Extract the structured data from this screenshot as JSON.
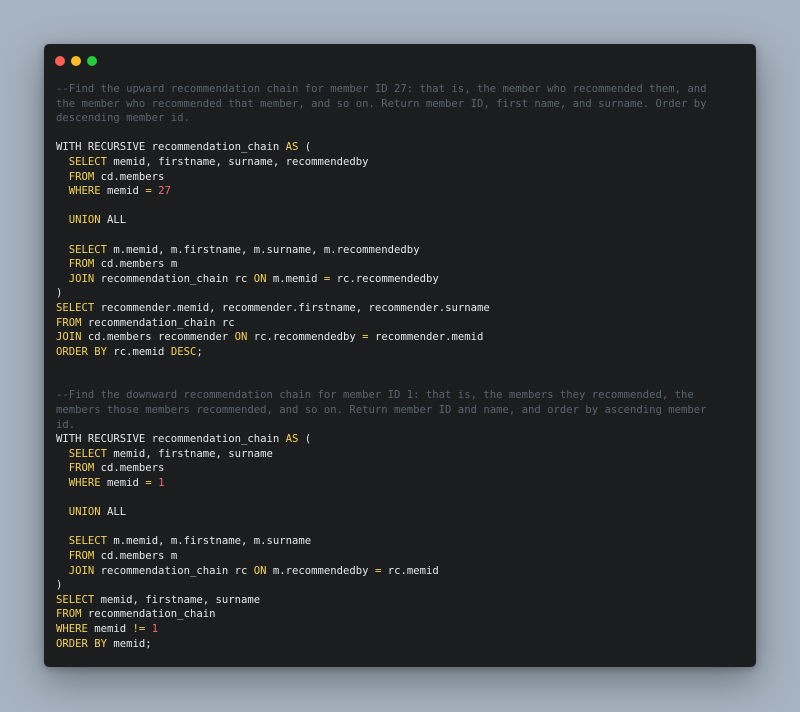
{
  "window": {
    "buttons": [
      {
        "name": "close",
        "color": "#ff5f57"
      },
      {
        "name": "minimize",
        "color": "#febc2e"
      },
      {
        "name": "zoom",
        "color": "#28c840"
      }
    ]
  },
  "colors": {
    "background": "#a6b3c0",
    "window": "#1c1d1f",
    "keyword": "#f4d35e",
    "number": "#ef6b73",
    "comment": "#5b6470",
    "text": "#e6e6e6"
  },
  "code": {
    "lines": [
      [
        [
          "c",
          "--Find the upward recommendation chain for member ID 27: that is, the member who recommended them, and"
        ]
      ],
      [
        [
          "c",
          "the member who recommended that member, and so on. Return member ID, first name, and surname. Order by"
        ]
      ],
      [
        [
          "c",
          "descending member id."
        ]
      ],
      [],
      [
        [
          "t",
          "WITH RECURSIVE recommendation_chain "
        ],
        [
          "k",
          "AS"
        ],
        [
          "t",
          " ("
        ]
      ],
      [
        [
          "t",
          "  "
        ],
        [
          "k",
          "SELECT"
        ],
        [
          "t",
          " memid, firstname, surname, recommendedby"
        ]
      ],
      [
        [
          "t",
          "  "
        ],
        [
          "k",
          "FROM"
        ],
        [
          "t",
          " cd.members"
        ]
      ],
      [
        [
          "t",
          "  "
        ],
        [
          "k",
          "WHERE"
        ],
        [
          "t",
          " memid "
        ],
        [
          "o",
          "="
        ],
        [
          "t",
          " "
        ],
        [
          "n",
          "27"
        ]
      ],
      [],
      [
        [
          "t",
          "  "
        ],
        [
          "k",
          "UNION"
        ],
        [
          "t",
          " ALL"
        ]
      ],
      [],
      [
        [
          "t",
          "  "
        ],
        [
          "k",
          "SELECT"
        ],
        [
          "t",
          " m.memid, m.firstname, m.surname, m.recommendedby"
        ]
      ],
      [
        [
          "t",
          "  "
        ],
        [
          "k",
          "FROM"
        ],
        [
          "t",
          " cd.members m"
        ]
      ],
      [
        [
          "t",
          "  "
        ],
        [
          "k",
          "JOIN"
        ],
        [
          "t",
          " recommendation_chain rc "
        ],
        [
          "k",
          "ON"
        ],
        [
          "t",
          " m.memid "
        ],
        [
          "o",
          "="
        ],
        [
          "t",
          " rc.recommendedby"
        ]
      ],
      [
        [
          "t",
          ")"
        ]
      ],
      [
        [
          "k",
          "SELECT"
        ],
        [
          "t",
          " recommender.memid, recommender.firstname, recommender.surname"
        ]
      ],
      [
        [
          "k",
          "FROM"
        ],
        [
          "t",
          " recommendation_chain rc"
        ]
      ],
      [
        [
          "k",
          "JOIN"
        ],
        [
          "t",
          " cd.members recommender "
        ],
        [
          "k",
          "ON"
        ],
        [
          "t",
          " rc.recommendedby "
        ],
        [
          "o",
          "="
        ],
        [
          "t",
          " recommender.memid"
        ]
      ],
      [
        [
          "k",
          "ORDER BY"
        ],
        [
          "t",
          " rc.memid "
        ],
        [
          "k",
          "DESC"
        ],
        [
          "t",
          ";"
        ]
      ],
      [],
      [],
      [
        [
          "c",
          "--Find the downward recommendation chain for member ID 1: that is, the members they recommended, the"
        ]
      ],
      [
        [
          "c",
          "members those members recommended, and so on. Return member ID and name, and order by ascending member"
        ]
      ],
      [
        [
          "c",
          "id."
        ]
      ],
      [
        [
          "t",
          "WITH RECURSIVE recommendation_chain "
        ],
        [
          "k",
          "AS"
        ],
        [
          "t",
          " ("
        ]
      ],
      [
        [
          "t",
          "  "
        ],
        [
          "k",
          "SELECT"
        ],
        [
          "t",
          " memid, firstname, surname"
        ]
      ],
      [
        [
          "t",
          "  "
        ],
        [
          "k",
          "FROM"
        ],
        [
          "t",
          " cd.members"
        ]
      ],
      [
        [
          "t",
          "  "
        ],
        [
          "k",
          "WHERE"
        ],
        [
          "t",
          " memid "
        ],
        [
          "o",
          "="
        ],
        [
          "t",
          " "
        ],
        [
          "n",
          "1"
        ]
      ],
      [],
      [
        [
          "t",
          "  "
        ],
        [
          "k",
          "UNION"
        ],
        [
          "t",
          " ALL"
        ]
      ],
      [],
      [
        [
          "t",
          "  "
        ],
        [
          "k",
          "SELECT"
        ],
        [
          "t",
          " m.memid, m.firstname, m.surname"
        ]
      ],
      [
        [
          "t",
          "  "
        ],
        [
          "k",
          "FROM"
        ],
        [
          "t",
          " cd.members m"
        ]
      ],
      [
        [
          "t",
          "  "
        ],
        [
          "k",
          "JOIN"
        ],
        [
          "t",
          " recommendation_chain rc "
        ],
        [
          "k",
          "ON"
        ],
        [
          "t",
          " m.recommendedby "
        ],
        [
          "o",
          "="
        ],
        [
          "t",
          " rc.memid"
        ]
      ],
      [
        [
          "t",
          ")"
        ]
      ],
      [
        [
          "k",
          "SELECT"
        ],
        [
          "t",
          " memid, firstname, surname"
        ]
      ],
      [
        [
          "k",
          "FROM"
        ],
        [
          "t",
          " recommendation_chain"
        ]
      ],
      [
        [
          "k",
          "WHERE"
        ],
        [
          "t",
          " memid "
        ],
        [
          "o",
          "!="
        ],
        [
          "t",
          " "
        ],
        [
          "n",
          "1"
        ]
      ],
      [
        [
          "k",
          "ORDER BY"
        ],
        [
          "t",
          " memid;"
        ]
      ]
    ]
  }
}
